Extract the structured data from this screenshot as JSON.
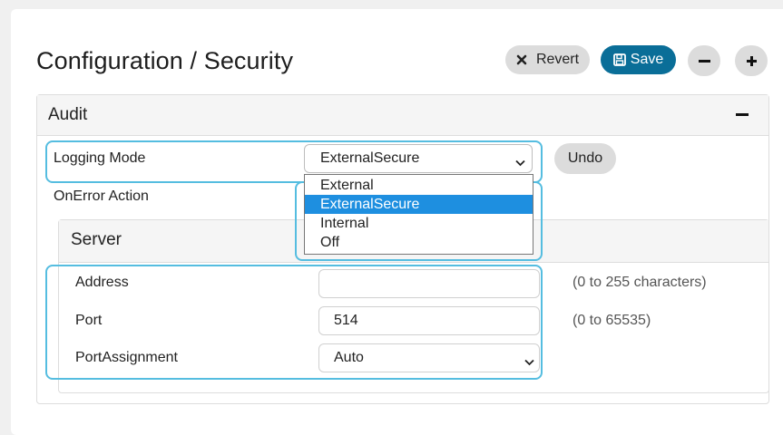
{
  "header": {
    "title": "Configuration / Security",
    "revert_label": "Revert",
    "save_label": "Save"
  },
  "audit": {
    "title": "Audit",
    "logging_mode_label": "Logging Mode",
    "logging_mode_value": "ExternalSecure",
    "undo_label": "Undo",
    "onerror_label": "OnError Action",
    "dropdown_options": [
      "External",
      "ExternalSecure",
      "Internal",
      "Off"
    ],
    "selected_option": "ExternalSecure"
  },
  "server": {
    "title": "Server",
    "address_label": "Address",
    "address_value": "",
    "address_hint": "(0 to 255 characters)",
    "port_label": "Port",
    "port_value": "514",
    "port_hint": "(0 to 65535)",
    "portassignment_label": "PortAssignment",
    "portassignment_value": "Auto"
  },
  "colors": {
    "accent": "#0a6e98",
    "highlight": "#55bde0",
    "selected_option": "#1e8fe0"
  },
  "icons": {
    "revert": "x-icon",
    "save": "floppy-disk-icon",
    "collapse": "minus-icon",
    "expand": "plus-icon",
    "select": "chevron-down-icon"
  }
}
